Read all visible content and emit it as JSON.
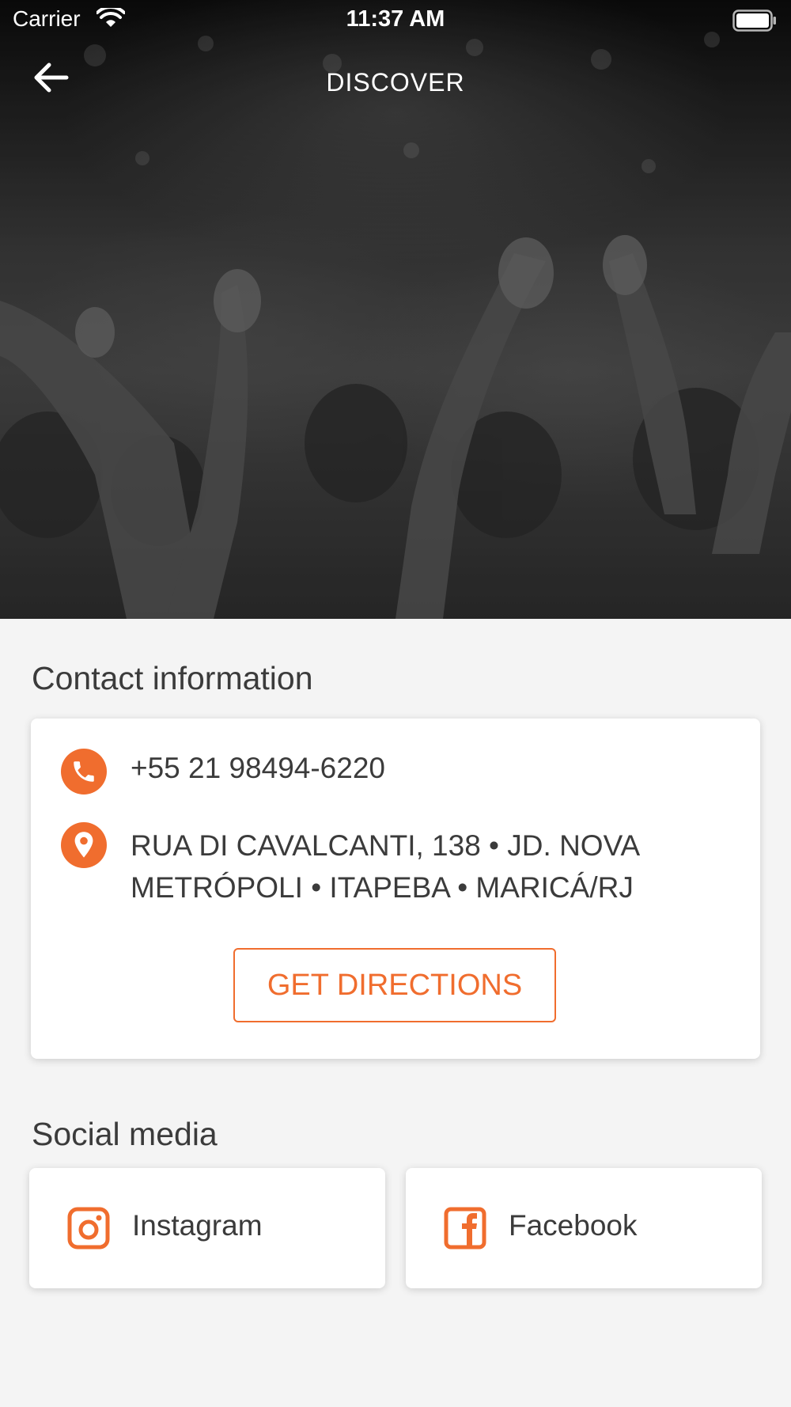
{
  "status_bar": {
    "carrier": "Carrier",
    "time": "11:37 AM"
  },
  "nav": {
    "title": "DISCOVER",
    "back_icon": "arrow-left-icon"
  },
  "contact": {
    "section_title": "Contact information",
    "phone": "+55 21 98494-6220",
    "address": "RUA DI CAVALCANTI, 138 • JD. NOVA METRÓPOLI • ITAPEBA • MARICÁ/RJ",
    "directions_label": "GET DIRECTIONS",
    "phone_icon": "phone-icon",
    "address_icon": "map-pin-icon"
  },
  "social": {
    "section_title": "Social media",
    "items": [
      {
        "label": "Instagram",
        "icon": "instagram-icon"
      },
      {
        "label": "Facebook",
        "icon": "facebook-icon"
      }
    ]
  },
  "colors": {
    "accent": "#f06d2e",
    "background": "#f4f4f4",
    "card": "#ffffff",
    "text": "#3b3b3b"
  }
}
